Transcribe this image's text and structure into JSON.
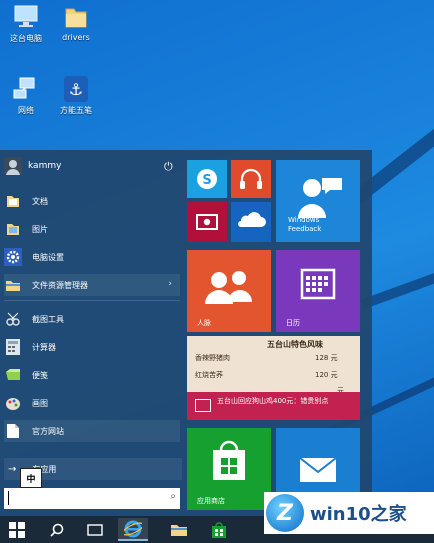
{
  "desktop_icons": [
    {
      "label": "这台电脑",
      "icon": "computer-icon"
    },
    {
      "label": "drivers",
      "icon": "folder-icon"
    },
    {
      "label": "网络",
      "icon": "network-icon"
    },
    {
      "label": "方能五笔",
      "icon": "anchor-icon"
    }
  ],
  "start_menu": {
    "user": "kammy",
    "power_glyph": "⏻",
    "items": [
      {
        "label": "文档",
        "icon": "documents-icon"
      },
      {
        "label": "图片",
        "icon": "pictures-icon"
      },
      {
        "label": "电脑设置",
        "icon": "settings-gear-icon"
      },
      {
        "label": "文件资源管理器",
        "icon": "file-explorer-icon",
        "has_arrow": true
      },
      {
        "label": "截图工具",
        "icon": "snipping-tool-icon"
      },
      {
        "label": "计算器",
        "icon": "calculator-icon"
      },
      {
        "label": "便笺",
        "icon": "sticky-notes-icon"
      },
      {
        "label": "画图",
        "icon": "paint-icon"
      },
      {
        "label": "官方网站",
        "icon": "document-page-icon"
      }
    ],
    "all_apps": "所有应用",
    "all_apps_visible": "有应用",
    "arrow": "→",
    "ime": "中",
    "search_glyph": "⌕"
  },
  "tiles": {
    "feedback": "Windows Feedback",
    "people": "人脉",
    "calendar": "日历",
    "store": "应用商店",
    "ad": {
      "title": "五台山特色风味",
      "rows": [
        {
          "name": "香辣野猪肉",
          "price": "128 元"
        },
        {
          "name": "红烧苦荞",
          "price": "120 元"
        },
        {
          "name": "",
          "price": "元"
        }
      ],
      "banner": "五台山回应狗山鸡400元：错贵别点"
    }
  },
  "watermark": {
    "text": "win10之家",
    "logo_letter": "Z"
  },
  "colors": {
    "skype": "#1ba1e2",
    "music": "#e04b2e",
    "video": "#b0103a",
    "onedrive": "#1565c0",
    "feedback": "#1d86d8",
    "people": "#e2552e",
    "calendar": "#7a38bd",
    "store": "#16a02f",
    "mail": "#1a7fd1",
    "ad_banner": "#c2224f"
  }
}
